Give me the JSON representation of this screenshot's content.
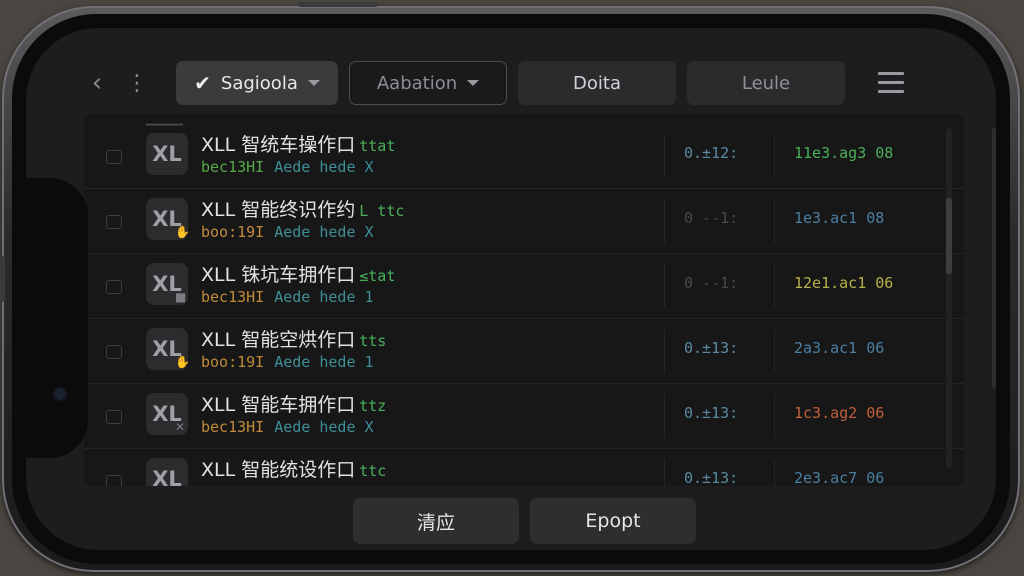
{
  "toolbar": {
    "back_icon": "chevron-left-icon",
    "more_icon": "vertical-dots-icon",
    "segments": [
      {
        "label": "Sagioola",
        "selected": true,
        "dropdown": true
      },
      {
        "label": "Aabation",
        "selected": false,
        "dropdown": true
      },
      {
        "label": "Doita",
        "selected": false,
        "dropdown": false
      },
      {
        "label": "Leule",
        "selected": false,
        "dropdown": false
      }
    ],
    "menu_icon": "hamburger-menu-icon"
  },
  "list": {
    "rows": [
      {
        "avatar": "XL",
        "title": "XLL 智统车操作口",
        "tag": "ttat",
        "tag_color": "#49b05a",
        "sub_a": "bec13HI",
        "sub_a_color": "#58a94a",
        "sub_b": "Aede hede X",
        "mid": "0.±12:",
        "mid_color": "#5a8aa0",
        "right": "11e3.ag3 08",
        "right_color": "#49b05a"
      },
      {
        "avatar": "XL",
        "title": "XLL 智能终识作约",
        "tag": "L ttc",
        "tag_color": "#49b05a",
        "sub_a": "boo:19I",
        "sub_a_color": "#c08a3a",
        "sub_b": "Aede hede X",
        "mid": "0 --1:",
        "mid_color": "#4a4a4e",
        "right": "1e3.ac1 08",
        "right_color": "#4a7fa0"
      },
      {
        "avatar": "XL",
        "title": "XLL 铢坑车拥作口",
        "tag": "≤tat",
        "tag_color": "#49b05a",
        "sub_a": "bec13HI",
        "sub_a_color": "#c08a3a",
        "sub_b": "Aede hede 1",
        "mid": "0 --1:",
        "mid_color": "#4a4a4e",
        "right": "12e1.ac1 06",
        "right_color": "#b8b04a"
      },
      {
        "avatar": "XL",
        "title": "XLL 智能空烘作口",
        "tag": "tts",
        "tag_color": "#49b05a",
        "sub_a": "boo:19I",
        "sub_a_color": "#c08a3a",
        "sub_b": "Aede hede 1",
        "mid": "0.±13:",
        "mid_color": "#5a8aa0",
        "right": "2a3.ac1 06",
        "right_color": "#4a7fa0"
      },
      {
        "avatar": "XL",
        "title": "XLL 智能车拥作口",
        "tag": "ttz",
        "tag_color": "#49b05a",
        "sub_a": "bec13HI",
        "sub_a_color": "#c08a3a",
        "sub_b": "Aede hede X",
        "mid": "0.±13:",
        "mid_color": "#5a8aa0",
        "right": "1c3.ag2 06",
        "right_color": "#c0603a"
      },
      {
        "avatar": "XL",
        "title": "XLL 智能统设作口",
        "tag": "ttc",
        "tag_color": "#49b05a",
        "sub_a": "",
        "sub_a_color": "#c08a3a",
        "sub_b": "",
        "mid": "0.±13:",
        "mid_color": "#5a8aa0",
        "right": "2e3.ac7 06",
        "right_color": "#4a7fa0"
      }
    ]
  },
  "bottom": {
    "clear_label": "清应",
    "export_label": "Epopt"
  }
}
